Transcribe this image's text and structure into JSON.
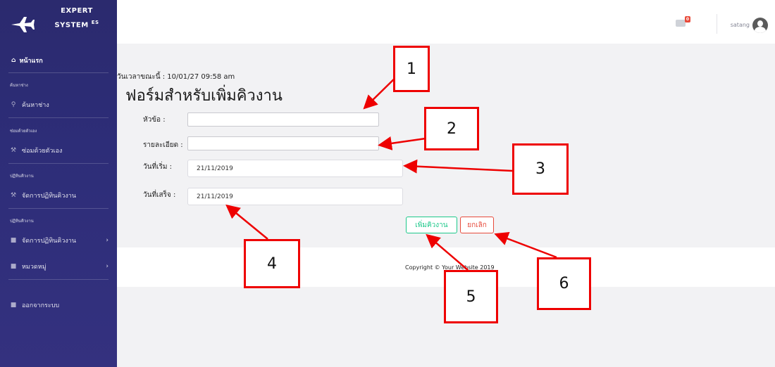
{
  "brand": {
    "line1": "EXPERT",
    "line2": "SYSTEM",
    "sup": "ES"
  },
  "sidebar": {
    "home_label": "หน้าแรก",
    "sections": [
      {
        "heading": "ค้นหาช่าง",
        "item": "ค้นหาช่าง"
      },
      {
        "heading": "ซ่อมด้วยตัวเอง",
        "item": "ซ่อมด้วยตัวเอง"
      },
      {
        "heading": "ปฏิทินคิวงาน",
        "item": "จัดการปฏิทินคิวงาน"
      },
      {
        "heading": "ปฏิทินคิวงาน",
        "item": "จัดการปฏิทินคิวงาน"
      }
    ],
    "category_label": "หมวดหมู่",
    "logout_label": "ออกจากระบบ"
  },
  "topbar": {
    "mail_badge": "0",
    "username": "satang"
  },
  "main": {
    "timestamp": "วันเวลาขณะนี้ : 10/01/27 09:58 am",
    "title": "ฟอร์มสำหรับเพิ่มคิวงาน",
    "fields": {
      "topic_label": "หัวข้อ :",
      "topic_value": "",
      "detail_label": "รายละเอียด :",
      "detail_value": "",
      "start_label": "วันที่เริ่ม :",
      "start_value": "21/11/2019",
      "end_label": "วันที่เสร็จ :",
      "end_value": "21/11/2019"
    },
    "add_button": "เพิ่มคิวงาน",
    "cancel_button": "ยกเลิก"
  },
  "footer": {
    "copyright": "Copyright © Your Website 2019"
  },
  "annotations": [
    "1",
    "2",
    "3",
    "4",
    "5",
    "6"
  ],
  "colors": {
    "sidebar": "#2d2d78",
    "add_button": "#1cc88a",
    "cancel_button": "#e74a3b",
    "annotation": "#e00000"
  }
}
